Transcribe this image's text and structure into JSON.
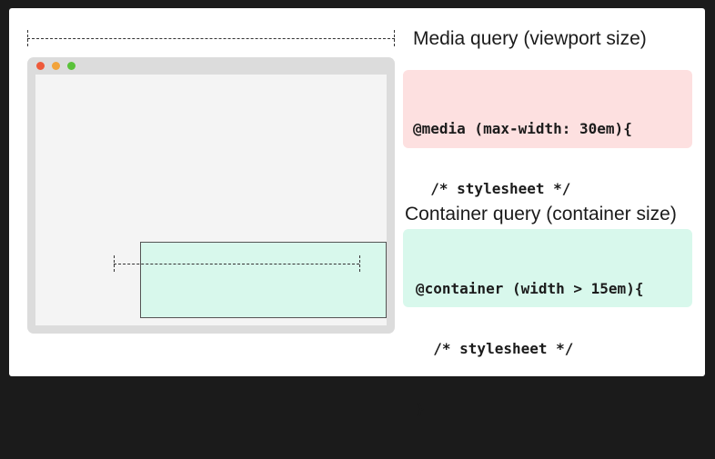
{
  "media_query": {
    "label": "Media query (viewport size)",
    "code_lines": [
      "@media (max-width: 30em){",
      "  /* stylesheet */",
      "}"
    ],
    "background": "#fde0e0"
  },
  "container_query": {
    "label": "Container query (container size)",
    "code_lines": [
      "@container (width > 15em){",
      "  /* stylesheet */",
      "}"
    ],
    "background": "#d8f8ec"
  },
  "window_controls": {
    "close": "#ee5a3a",
    "minimize": "#f2a33a",
    "maximize": "#5ac23a"
  }
}
